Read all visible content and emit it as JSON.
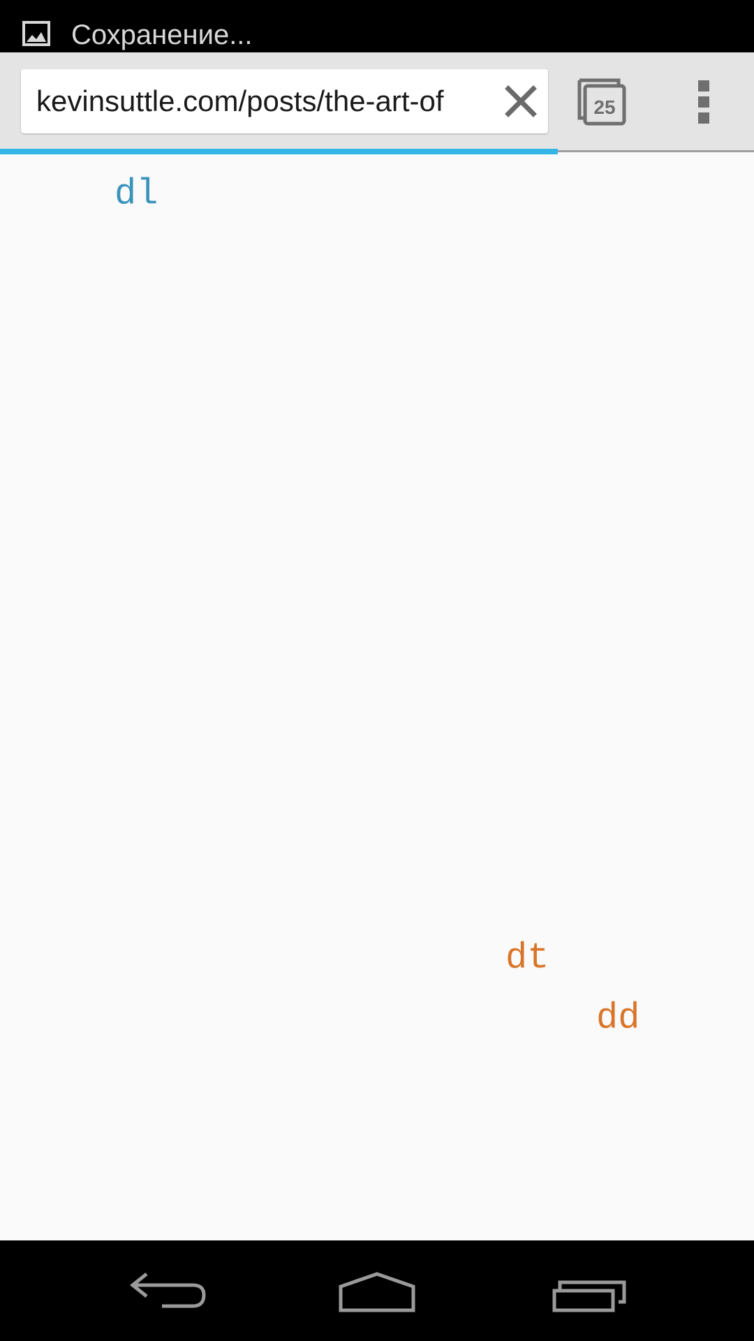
{
  "status_bar": {
    "notification_icon": "image-icon",
    "text": "Сохранение..."
  },
  "toolbar": {
    "url": "kevinsuttle.com/posts/the-art-of",
    "clear_icon": "close-icon",
    "tab_count": "25",
    "menu_icon": "overflow-menu-icon"
  },
  "page_load_progress": 0.74,
  "page": {
    "tags": [
      "dl",
      "dt",
      "dd"
    ]
  },
  "colors": {
    "accent_blue": "#33b5e5",
    "tag_blue": "#3b93bb",
    "tag_orange": "#d9752a"
  },
  "nav_bar": {
    "back_icon": "back-icon",
    "home_icon": "home-icon",
    "recents_icon": "recent-apps-icon"
  }
}
